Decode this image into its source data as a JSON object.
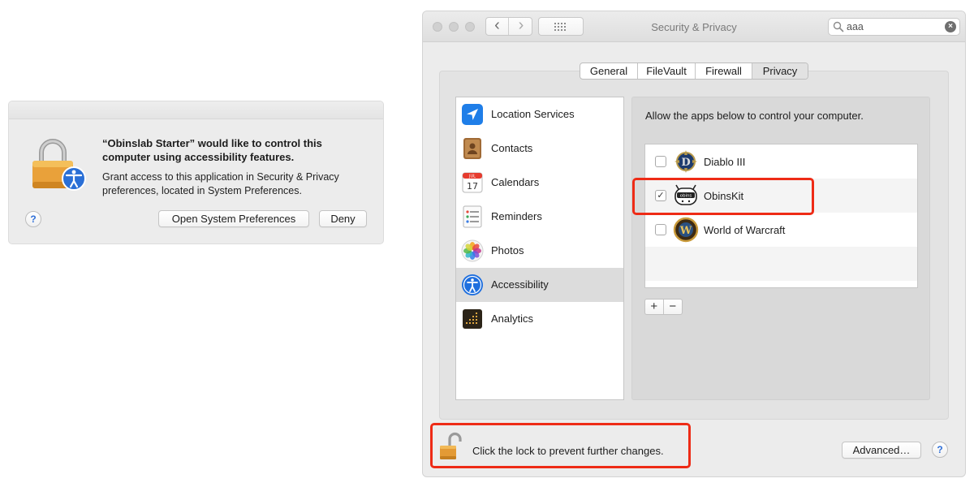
{
  "alert": {
    "title": "“Obinslab Starter” would like to control this computer using accessibility features.",
    "message": "Grant access to this application in Security & Privacy preferences, located in System Preferences.",
    "open_prefs_label": "Open System Preferences",
    "deny_label": "Deny",
    "help_label": "?"
  },
  "window": {
    "title": "Security & Privacy",
    "back_glyph": "‹",
    "forward_glyph": "›",
    "search": {
      "value": "aaa",
      "clear_glyph": "×"
    },
    "tabs": [
      {
        "label": "General"
      },
      {
        "label": "FileVault"
      },
      {
        "label": "Firewall"
      },
      {
        "label": "Privacy"
      }
    ],
    "active_tab": "Privacy",
    "categories": [
      {
        "label": "Location Services",
        "icon": "location-arrow-icon"
      },
      {
        "label": "Contacts",
        "icon": "contacts-book-icon"
      },
      {
        "label": "Calendars",
        "icon": "calendar-icon",
        "icon_month": "JUL",
        "icon_day": "17"
      },
      {
        "label": "Reminders",
        "icon": "reminders-list-icon"
      },
      {
        "label": "Photos",
        "icon": "photos-flower-icon"
      },
      {
        "label": "Accessibility",
        "icon": "accessibility-person-icon"
      },
      {
        "label": "Analytics",
        "icon": "analytics-icon"
      }
    ],
    "selected_category": "Accessibility",
    "panel": {
      "description": "Allow the apps below to control your computer.",
      "apps": [
        {
          "label": "Diablo III",
          "checked": false,
          "icon": "diablo-icon"
        },
        {
          "label": "ObinsKit",
          "checked": true,
          "icon": "obinskit-icon",
          "icon_text": "obins"
        },
        {
          "label": "World of Warcraft",
          "checked": false,
          "icon": "warcraft-icon"
        }
      ],
      "add_glyph": "+",
      "remove_glyph": "−"
    },
    "lock_text": "Click the lock to prevent further changes.",
    "advanced_label": "Advanced…",
    "help_label": "?"
  },
  "colors": {
    "highlight": "#ee2b16",
    "accent_blue": "#2f6fd8",
    "window_bg": "#ececec",
    "selection_bg": "#dcdcdc"
  }
}
